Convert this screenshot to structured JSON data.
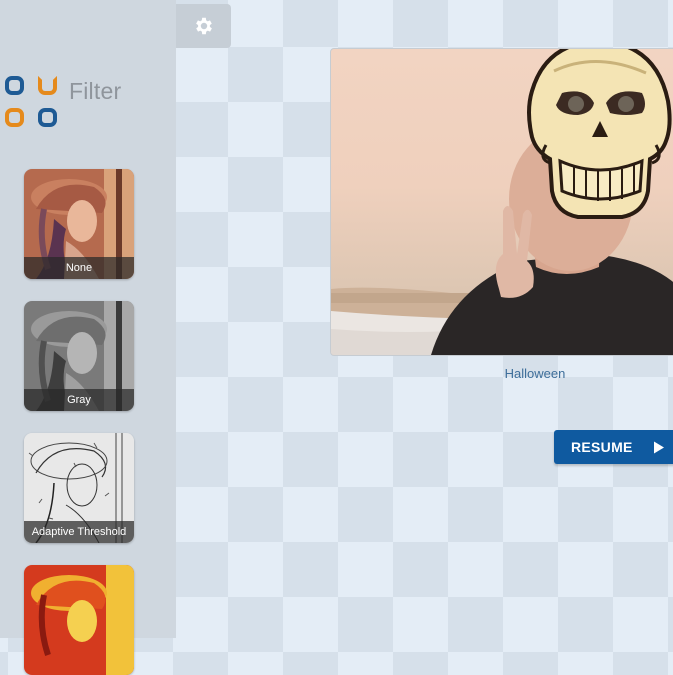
{
  "app": {
    "logo_text": "Filter"
  },
  "sidebar": {
    "filters": [
      {
        "label": "None"
      },
      {
        "label": "Gray"
      },
      {
        "label": "Adaptive Threshold"
      },
      {
        "label": ""
      }
    ]
  },
  "main": {
    "current_filter_caption": "Halloween",
    "resume_label": "RESUME"
  },
  "icons": {
    "settings": "gear-icon",
    "play": "play-icon"
  },
  "colors": {
    "accent_blue": "#0f5aa0",
    "logo_blue": "#1e5a94",
    "logo_orange": "#e58a1c"
  }
}
